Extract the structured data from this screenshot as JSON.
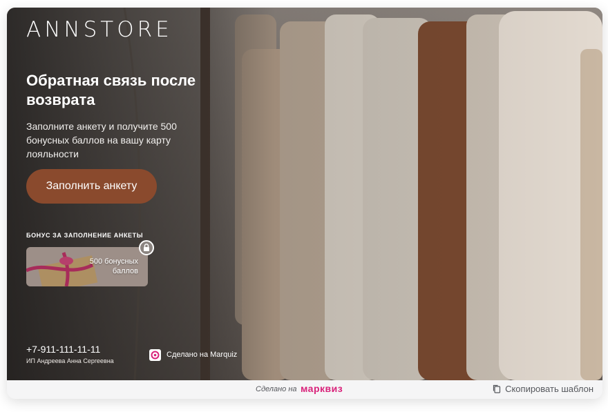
{
  "header": {
    "logo_text": "ANNSTORE"
  },
  "hero": {
    "title": "Обратная связь после возврата",
    "subtitle": "Заполните анкету и получите 500 бонусных баллов на вашу карту лояльности",
    "cta_label": "Заполнить анкету"
  },
  "bonus": {
    "label": "БОНУС ЗА ЗАПОЛНЕНИЕ АНКЕТЫ",
    "card_text": "500 бонусных баллов",
    "icon": "lock-icon"
  },
  "footer": {
    "phone": "+7-911-111-11-11",
    "owner": "ИП Андреева Анна Сергеевна",
    "made_with": "Сделано на Marquiz"
  },
  "bottombar": {
    "made_on": "Сделано на",
    "brand": "марквиз",
    "copy_label": "Скопировать шаблон",
    "copy_icon": "copy-icon"
  },
  "colors": {
    "cta": "#8a4a2d",
    "brand": "#d9227a",
    "bottombar_bg": "#f5f5f6"
  }
}
